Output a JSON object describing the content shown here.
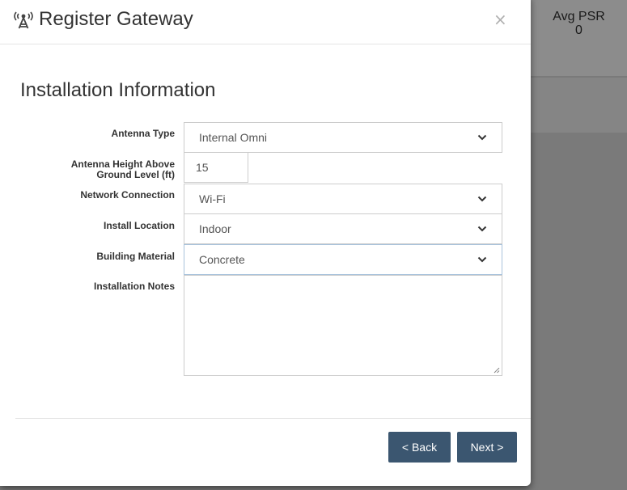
{
  "backdrop": {
    "stat_label": "Avg PSR",
    "stat_value": "0"
  },
  "modal": {
    "title": "Register Gateway",
    "close_label": "×",
    "section_title": "Installation Information",
    "fields": {
      "antenna_type": {
        "label": "Antenna Type",
        "value": "Internal Omni"
      },
      "antenna_height": {
        "label_line1": "Antenna Height Above",
        "label_line2": "Ground Level (ft)",
        "value": "15"
      },
      "network_connection": {
        "label": "Network Connection",
        "value": "Wi-Fi"
      },
      "install_location": {
        "label": "Install Location",
        "value": "Indoor"
      },
      "building_material": {
        "label": "Building Material",
        "value": "Concrete"
      },
      "installation_notes": {
        "label": "Installation Notes",
        "value": ""
      }
    },
    "buttons": {
      "back": "< Back",
      "next": "Next >"
    }
  },
  "colors": {
    "primary_button": "#3b5670",
    "backdrop": "#7a7a7a"
  },
  "icons": {
    "title": "antenna-tower-icon",
    "select": "chevron-down-icon"
  }
}
